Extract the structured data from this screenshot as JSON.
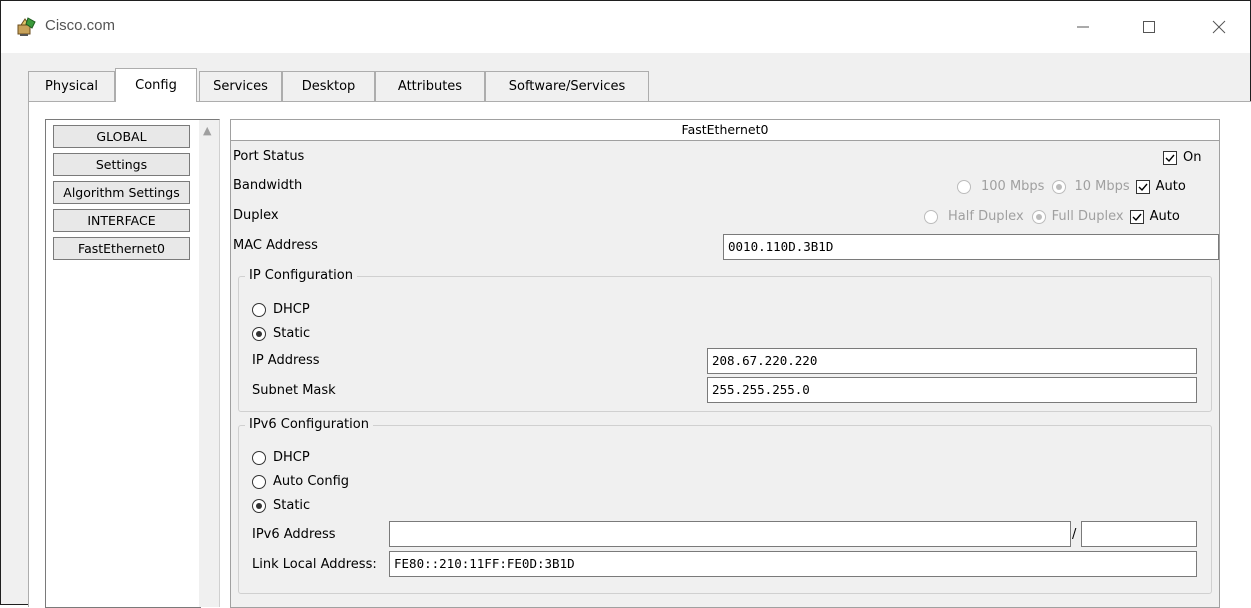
{
  "window": {
    "title": "Cisco.com",
    "icon": "packet-tracer-pc-icon",
    "controls": [
      "minimize-icon",
      "maximize-icon",
      "close-icon"
    ]
  },
  "tabs": [
    {
      "label": "Physical",
      "active": false
    },
    {
      "label": "Config",
      "active": true
    },
    {
      "label": "Services",
      "active": false
    },
    {
      "label": "Desktop",
      "active": false
    },
    {
      "label": "Attributes",
      "active": false
    },
    {
      "label": "Software/Services",
      "active": false
    }
  ],
  "sidebar": {
    "items": [
      "GLOBAL",
      "Settings",
      "Algorithm Settings",
      "INTERFACE",
      "FastEthernet0"
    ]
  },
  "interface": {
    "name": "FastEthernet0",
    "port_status": {
      "label": "Port Status",
      "on_label": "On",
      "on": true
    },
    "bandwidth": {
      "label": "Bandwidth",
      "opt1": "100 Mbps",
      "opt2": "10 Mbps",
      "auto_label": "Auto",
      "selected": "10 Mbps",
      "auto": true
    },
    "duplex": {
      "label": "Duplex",
      "opt1": "Half Duplex",
      "opt2": "Full Duplex",
      "auto_label": "Auto",
      "selected": "Full Duplex",
      "auto": true
    },
    "mac": {
      "label": "MAC Address",
      "value": "0010.110D.3B1D"
    }
  },
  "ipv4": {
    "title": "IP Configuration",
    "dhcp_label": "DHCP",
    "static_label": "Static",
    "mode": "Static",
    "ip_label": "IP Address",
    "ip_value": "208.67.220.220",
    "mask_label": "Subnet Mask",
    "mask_value": "255.255.255.0"
  },
  "ipv6": {
    "title": "IPv6 Configuration",
    "dhcp_label": "DHCP",
    "auto_label": "Auto Config",
    "static_label": "Static",
    "mode": "Static",
    "addr_label": "IPv6 Address",
    "addr_value": "",
    "prefix_sep": "/",
    "prefix_value": "",
    "link_local_label": "Link Local Address:",
    "link_local_value": "FE80::210:11FF:FE0D:3B1D"
  }
}
